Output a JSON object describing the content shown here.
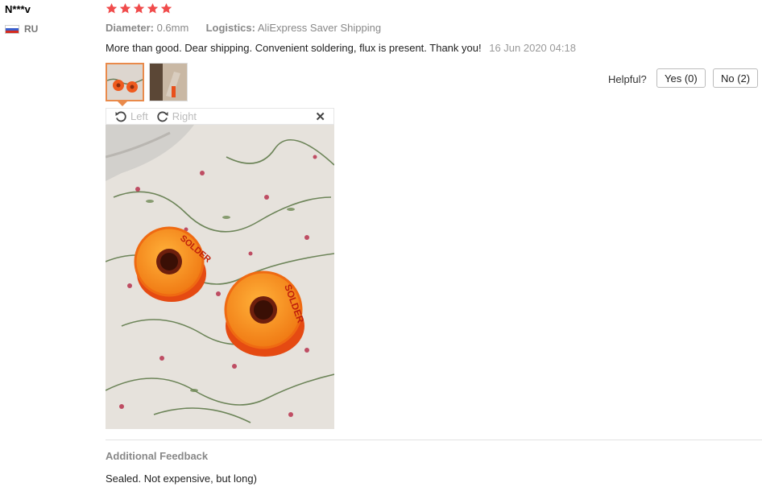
{
  "reviewer": {
    "name": "N***v",
    "country": "RU"
  },
  "rating": {
    "stars": 5,
    "color": "#f04b4b"
  },
  "attributes": [
    {
      "key": "Diameter:",
      "value": "0.6mm"
    },
    {
      "key": "Logistics:",
      "value": "AliExpress Saver Shipping"
    }
  ],
  "review": {
    "text": "More than good. Dear shipping. Convenient soldering, flux is present. Thank you!",
    "date": "16 Jun 2020 04:18"
  },
  "helpful": {
    "label": "Helpful?",
    "yes": "Yes (0)",
    "no": "No (2)"
  },
  "viewer": {
    "left": "Left",
    "right": "Right",
    "close": "✕"
  },
  "photo": {
    "spool_label": "SOLDER"
  },
  "additional_feedback": {
    "title": "Additional Feedback",
    "text": "Sealed. Not expensive, but long)"
  },
  "colors": {
    "accent": "#e98a4b",
    "star": "#f04b4b"
  }
}
